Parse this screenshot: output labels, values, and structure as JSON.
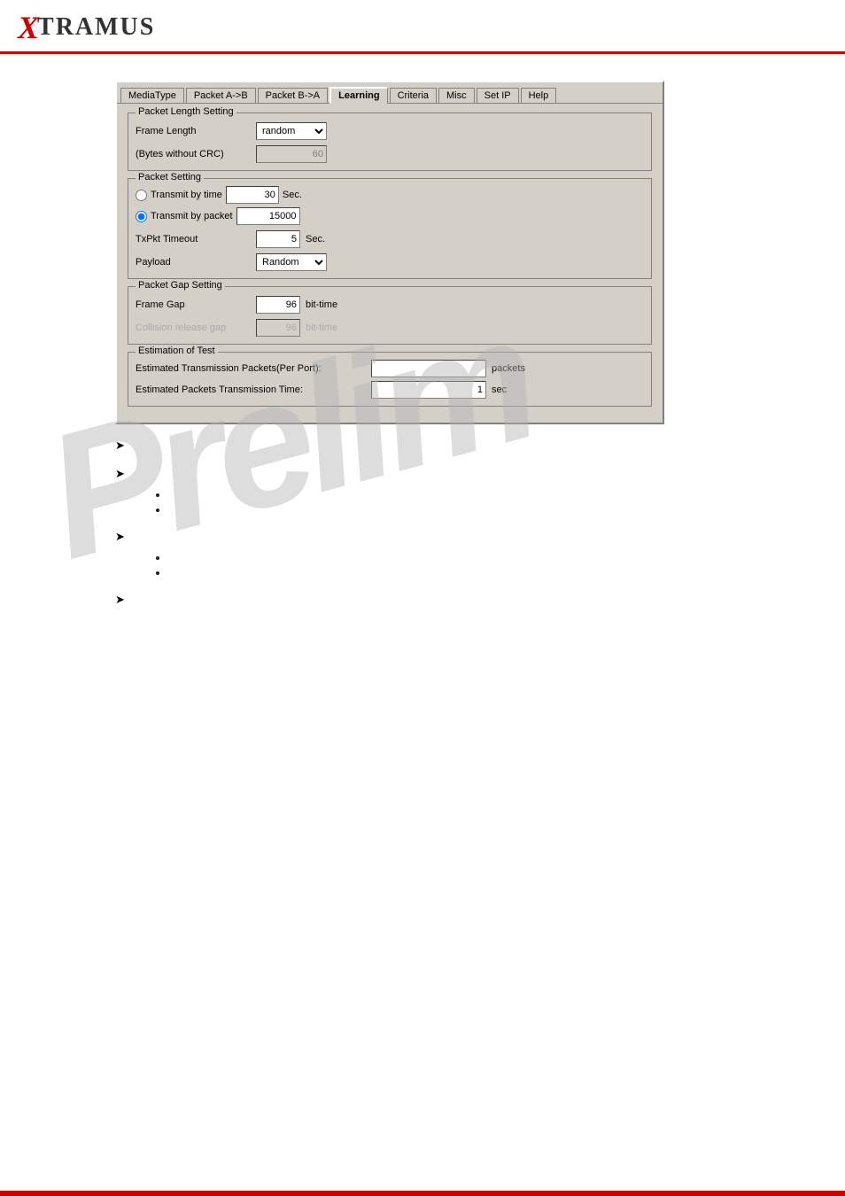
{
  "header": {
    "logo_x": "X",
    "logo_tramus": "TRAMUS"
  },
  "tabs": {
    "items": [
      {
        "label": "MediaType",
        "active": false
      },
      {
        "label": "Packet A->B",
        "active": false
      },
      {
        "label": "Packet B->A",
        "active": false
      },
      {
        "label": "Learning",
        "active": true
      },
      {
        "label": "Criteria",
        "active": false
      },
      {
        "label": "Misc",
        "active": false
      },
      {
        "label": "Set IP",
        "active": false
      },
      {
        "label": "Help",
        "active": false
      }
    ]
  },
  "packet_length_setting": {
    "label": "Packet Length Setting",
    "frame_length_label": "Frame Length",
    "frame_length_value": "random",
    "bytes_crc_label": "(Bytes without CRC)",
    "bytes_value": "60"
  },
  "packet_setting": {
    "label": "Packet Setting",
    "transmit_time_label": "Transmit by time",
    "transmit_time_value": "30",
    "transmit_time_unit": "Sec.",
    "transmit_packet_label": "Transmit by packet",
    "transmit_packet_value": "15000",
    "txpkt_timeout_label": "TxPkt Timeout",
    "txpkt_timeout_value": "5",
    "txpkt_timeout_unit": "Sec.",
    "payload_label": "Payload",
    "payload_value": "Random"
  },
  "packet_gap_setting": {
    "label": "Packet Gap Setting",
    "frame_gap_label": "Frame Gap",
    "frame_gap_value": "96",
    "frame_gap_unit": "bit-time",
    "collision_gap_label": "Collision release gap",
    "collision_gap_value": "96",
    "collision_gap_unit": "bit-time"
  },
  "estimation": {
    "label": "Estimation of Test",
    "packets_label": "Estimated Transmission Packets(Per Port):",
    "packets_unit": "packets",
    "packets_value": "",
    "time_label": "Estimated Packets Transmission Time:",
    "time_unit": "sec",
    "time_value": "1"
  },
  "watermark": "Prelim",
  "bullets": [
    {
      "symbol": "➤",
      "text": ""
    },
    {
      "symbol": "➤",
      "text": "",
      "sub_bullets": [
        "",
        ""
      ]
    },
    {
      "symbol": "➤",
      "text": "",
      "sub_bullets": [
        "",
        ""
      ]
    },
    {
      "symbol": "➤",
      "text": ""
    }
  ]
}
